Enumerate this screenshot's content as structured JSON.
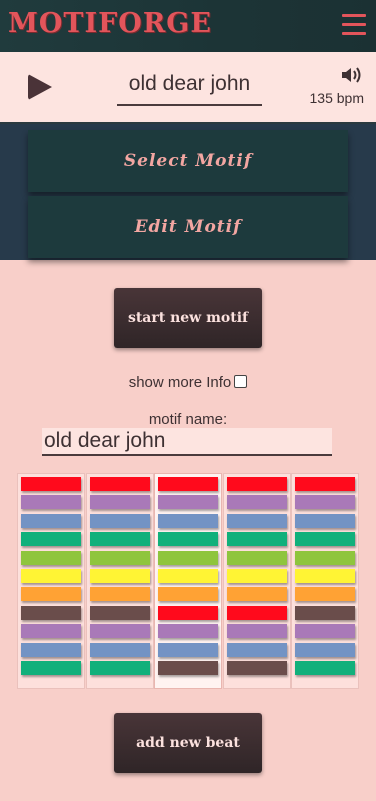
{
  "app": {
    "title": "MOTIFORGE"
  },
  "player": {
    "title": "old dear john",
    "bpm": "135 bpm"
  },
  "menu": {
    "select_label": "Select Motif",
    "edit_label": "Edit Motif"
  },
  "actions": {
    "start_new_label": "start new motif",
    "add_beat_label": "add new beat"
  },
  "options": {
    "show_more_label": "show more Info"
  },
  "motif": {
    "name_label": "motif name:",
    "name_value": "old dear john"
  },
  "colors": {
    "red": "#ff0a1c",
    "purple": "#a979b8",
    "blue": "#7393c4",
    "green": "#11b07b",
    "lime": "#8fc53d",
    "yellow": "#fff434",
    "orange": "#ffa234",
    "brown": "#6a4d4b"
  },
  "beats": [
    [
      "red",
      "purple",
      "blue",
      "green",
      "lime",
      "yellow",
      "orange",
      "brown",
      "purple",
      "blue",
      "green"
    ],
    [
      "red",
      "purple",
      "blue",
      "green",
      "lime",
      "yellow",
      "orange",
      "brown",
      "purple",
      "blue",
      "green"
    ],
    [
      "red",
      "purple",
      "blue",
      "green",
      "lime",
      "yellow",
      "orange",
      "red",
      "purple",
      "blue",
      "brown"
    ],
    [
      "red",
      "purple",
      "blue",
      "green",
      "lime",
      "yellow",
      "orange",
      "red",
      "purple",
      "blue",
      "brown"
    ],
    [
      "red",
      "purple",
      "blue",
      "green",
      "lime",
      "yellow",
      "orange",
      "brown",
      "purple",
      "blue",
      "green"
    ]
  ],
  "selected_beat": 2
}
